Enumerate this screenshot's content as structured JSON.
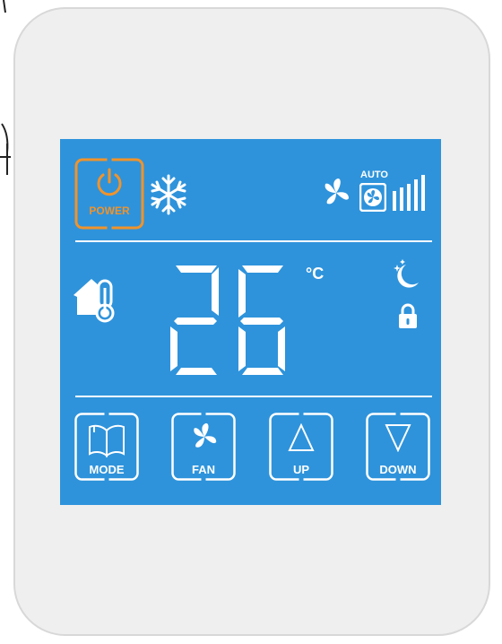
{
  "thermostat": {
    "power_label": "POWER",
    "fan_auto_label": "AUTO",
    "fan_speed_bars": 5,
    "temperature": "26",
    "temperature_unit": "°C",
    "buttons": [
      {
        "label": "MODE",
        "icon": "book-icon"
      },
      {
        "label": "FAN",
        "icon": "fan-icon"
      },
      {
        "label": "UP",
        "icon": "up-arrow-icon"
      },
      {
        "label": "DOWN",
        "icon": "down-arrow-icon"
      }
    ]
  },
  "colors": {
    "screen": "#2e93db",
    "power_accent": "#f0932b",
    "body": "#efefef"
  }
}
